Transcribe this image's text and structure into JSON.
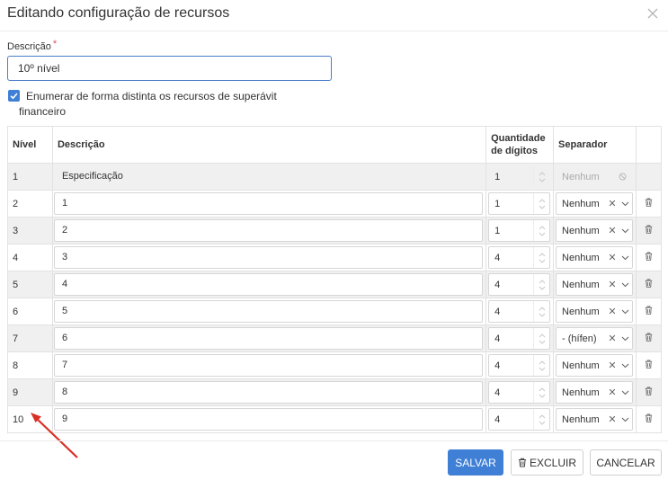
{
  "dialog": {
    "title": "Editando configuração de recursos"
  },
  "form": {
    "description_label": "Descrição",
    "required_mark": "*",
    "description_value": "10º nível",
    "checkbox_label_line1": "Enumerar de forma distinta os recursos de superávit",
    "checkbox_label_line2": "financeiro",
    "checkbox_checked": true
  },
  "table": {
    "headers": {
      "nivel": "Nível",
      "descricao": "Descrição",
      "quantidade_line1": "Quantidade",
      "quantidade_line2": "de dígitos",
      "separador": "Separador"
    },
    "rows": [
      {
        "nivel": "1",
        "descricao": "Especificação",
        "digitos": "1",
        "separador": "Nenhum",
        "editable": false
      },
      {
        "nivel": "2",
        "descricao": "1",
        "digitos": "1",
        "separador": "Nenhum",
        "editable": true
      },
      {
        "nivel": "3",
        "descricao": "2",
        "digitos": "1",
        "separador": "Nenhum",
        "editable": true
      },
      {
        "nivel": "4",
        "descricao": "3",
        "digitos": "4",
        "separador": "Nenhum",
        "editable": true
      },
      {
        "nivel": "5",
        "descricao": "4",
        "digitos": "4",
        "separador": "Nenhum",
        "editable": true
      },
      {
        "nivel": "6",
        "descricao": "5",
        "digitos": "4",
        "separador": "Nenhum",
        "editable": true
      },
      {
        "nivel": "7",
        "descricao": "6",
        "digitos": "4",
        "separador": "- (hífen)",
        "editable": true
      },
      {
        "nivel": "8",
        "descricao": "7",
        "digitos": "4",
        "separador": "Nenhum",
        "editable": true
      },
      {
        "nivel": "9",
        "descricao": "8",
        "digitos": "4",
        "separador": "Nenhum",
        "editable": true
      },
      {
        "nivel": "10",
        "descricao": "9",
        "digitos": "4",
        "separador": "Nenhum",
        "editable": true
      }
    ]
  },
  "buttons": {
    "save": "SALVAR",
    "delete": "EXCLUIR",
    "cancel": "CANCELAR"
  },
  "icons": {
    "close": "close-icon",
    "checkbox": "check-icon",
    "spinner": "spinner-arrows-icon",
    "clear": "clear-x-icon",
    "dropdown": "chevron-down-icon",
    "disabled": "ban-icon",
    "trash": "trash-icon",
    "annotation": "red-arrow-icon"
  },
  "colors": {
    "primary": "#3f7fd6",
    "annotation_arrow": "#d93025",
    "row_shade": "#f0f0f0",
    "required": "#d9534f"
  }
}
